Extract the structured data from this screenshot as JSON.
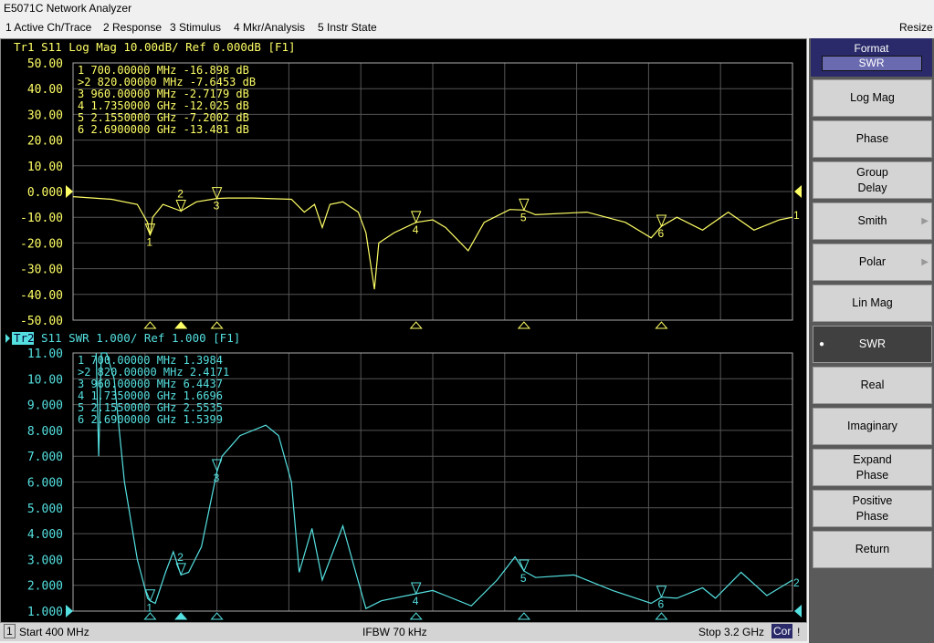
{
  "window": {
    "title": "E5071C Network Analyzer",
    "resize": "Resize"
  },
  "menu": [
    "1 Active Ch/Trace",
    "2 Response",
    "3 Stimulus",
    "4 Mkr/Analysis",
    "5 Instr State"
  ],
  "tr1": {
    "header": "Tr1 S11 Log Mag 10.00dB/ Ref 0.000dB [F1]",
    "color": "#ffff66",
    "yticks": [
      "50.00",
      "40.00",
      "30.00",
      "20.00",
      "10.00",
      "0.000",
      "-10.00",
      "-20.00",
      "-30.00",
      "-40.00",
      "-50.00"
    ],
    "markers": [
      "  1  700.00000 MHz -16.898 dB",
      ">2  820.00000 MHz -7.6453 dB",
      "  3  960.00000 MHz -2.7179 dB",
      "  4  1.7350000 GHz -12.025 dB",
      "  5  2.1550000 GHz -7.2002 dB",
      "  6  2.6900000 GHz -13.481 dB"
    ]
  },
  "tr2": {
    "label": "Tr2",
    "header": "S11 SWR 1.000/ Ref 1.000 [F1]",
    "color": "#55e0e0",
    "yticks": [
      "11.00",
      "10.00",
      "9.000",
      "8.000",
      "7.000",
      "6.000",
      "5.000",
      "4.000",
      "3.000",
      "2.000",
      "1.000"
    ],
    "markers": [
      "  1  700.00000 MHz  1.3984",
      ">2  820.00000 MHz  2.4171",
      "  3  960.00000 MHz  6.4437",
      "  4  1.7350000 GHz  1.6696",
      "  5  2.1550000 GHz  2.5535",
      "  6  2.6900000 GHz  1.5399"
    ]
  },
  "chart_data": [
    {
      "type": "line",
      "title": "Tr1 S11 Log Mag 10.00dB/ Ref 0.000dB [F1]",
      "xlim": [
        400,
        3200
      ],
      "ylim": [
        -50,
        50
      ],
      "grid": true,
      "x": [
        400,
        550,
        650,
        690,
        700,
        710,
        750,
        820,
        880,
        960,
        1000,
        1100,
        1250,
        1300,
        1340,
        1370,
        1400,
        1450,
        1510,
        1540,
        1573,
        1590,
        1650,
        1735,
        1800,
        1850,
        1938,
        2000,
        2100,
        2155,
        2200,
        2400,
        2550,
        2650,
        2690,
        2750,
        2850,
        2950,
        3050,
        3150,
        3200
      ],
      "y": [
        -2,
        -3,
        -5,
        -12,
        -17,
        -10,
        -5,
        -7.6,
        -4,
        -2.7,
        -2.5,
        -2.5,
        -3,
        -8,
        -5,
        -14,
        -5,
        -4,
        -8,
        -16,
        -38,
        -20,
        -16,
        -12,
        -11,
        -14,
        -23,
        -12,
        -7,
        -7.2,
        -9,
        -8,
        -12,
        -18,
        -13.5,
        -10,
        -15,
        -8,
        -15,
        -11,
        -10
      ],
      "marker_x": [
        700,
        820,
        960,
        1735,
        2155,
        2690
      ],
      "marker_y": [
        -16.898,
        -7.6453,
        -2.7179,
        -12.025,
        -7.2002,
        -13.481
      ]
    },
    {
      "type": "line",
      "title": "S11 SWR 1.000/ Ref 1.000 [F1]",
      "xlim": [
        400,
        3200
      ],
      "ylim": [
        1,
        11
      ],
      "grid": true,
      "x": [
        490,
        500,
        510,
        530,
        560,
        600,
        650,
        690,
        700,
        720,
        760,
        790,
        820,
        850,
        900,
        960,
        980,
        1050,
        1150,
        1200,
        1250,
        1280,
        1330,
        1370,
        1450,
        1500,
        1540,
        1600,
        1735,
        1800,
        1850,
        1950,
        2050,
        2120,
        2155,
        2200,
        2350,
        2500,
        2650,
        2690,
        2750,
        2850,
        2900,
        3000,
        3100,
        3200
      ],
      "y": [
        11,
        7,
        11,
        11,
        10,
        6,
        3,
        1.5,
        1.4,
        1.3,
        2.5,
        3.3,
        2.4,
        2.5,
        3.5,
        6.4,
        7,
        7.8,
        8.2,
        7.8,
        6,
        2.5,
        4.2,
        2.2,
        4.3,
        2.5,
        1.1,
        1.4,
        1.67,
        1.8,
        1.6,
        1.2,
        2.2,
        3.1,
        2.55,
        2.3,
        2.4,
        1.8,
        1.3,
        1.54,
        1.5,
        1.9,
        1.5,
        2.5,
        1.6,
        2.2
      ],
      "marker_x": [
        700,
        820,
        960,
        1735,
        2155,
        2690
      ],
      "marker_y": [
        1.3984,
        2.4171,
        6.4437,
        1.6696,
        2.5535,
        1.5399
      ]
    }
  ],
  "sidebar": {
    "title": "Format",
    "value": "SWR",
    "buttons": [
      "Log Mag",
      "Phase",
      "Group Delay",
      "Smith",
      "Polar",
      "Lin Mag",
      "SWR",
      "Real",
      "Imaginary",
      "Expand Phase",
      "Positive Phase",
      "Return"
    ],
    "selected": "SWR"
  },
  "status": {
    "channel": "1",
    "start": "Start 400 MHz",
    "ifbw": "IFBW 70 kHz",
    "stop": "Stop 3.2 GHz",
    "cor": "Cor",
    "flag": "!"
  }
}
